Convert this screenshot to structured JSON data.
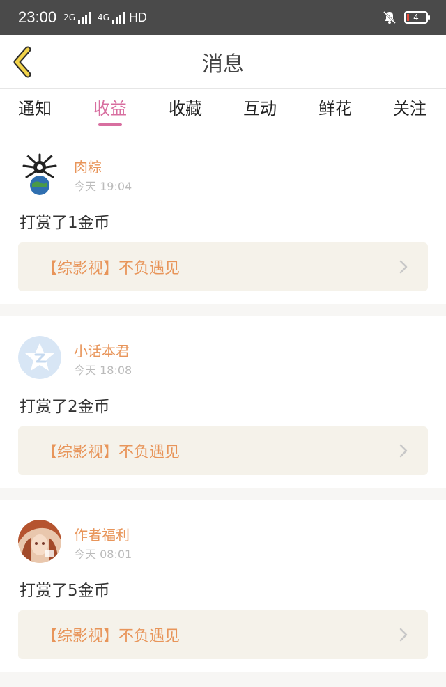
{
  "status_bar": {
    "time": "23:00",
    "net1": "2G",
    "net2": "4G",
    "hd": "HD",
    "battery": "4"
  },
  "header": {
    "title": "消息",
    "back_icon": "chevron-left-icon"
  },
  "tabs": [
    {
      "label": "通知",
      "active": false
    },
    {
      "label": "收益",
      "active": true
    },
    {
      "label": "收藏",
      "active": false
    },
    {
      "label": "互动",
      "active": false
    },
    {
      "label": "鲜花",
      "active": false
    },
    {
      "label": "关注",
      "active": false
    }
  ],
  "items": [
    {
      "user": "肉粽",
      "time": "今天 19:04",
      "action": "打赏了1金币",
      "book": "【综影视】不负遇见"
    },
    {
      "user": "小话本君",
      "time": "今天 18:08",
      "action": "打赏了2金币",
      "book": "【综影视】不负遇见"
    },
    {
      "user": "作者福利",
      "time": "今天 08:01",
      "action": "打赏了5金币",
      "book": "【综影视】不负遇见"
    }
  ],
  "colors": {
    "accent_pink": "#d86fa0",
    "accent_orange": "#e8955a",
    "back_yellow": "#f2d34a"
  }
}
